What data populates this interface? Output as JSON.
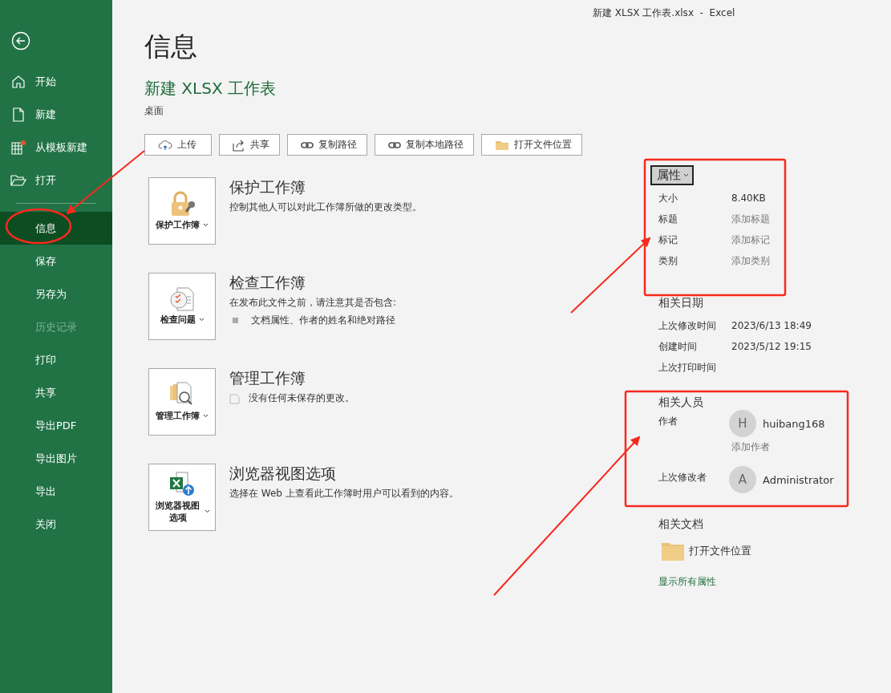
{
  "window": {
    "title": "新建 XLSX 工作表.xlsx  -  Excel"
  },
  "sidebar": {
    "items": [
      {
        "label": "开始",
        "selected": false,
        "disabled": false
      },
      {
        "label": "新建",
        "selected": false,
        "disabled": false
      },
      {
        "label": "从模板新建",
        "selected": false,
        "disabled": false
      },
      {
        "label": "打开",
        "selected": false,
        "disabled": false
      },
      {
        "label": "信息",
        "selected": true,
        "disabled": false
      },
      {
        "label": "保存",
        "selected": false,
        "disabled": false
      },
      {
        "label": "另存为",
        "selected": false,
        "disabled": false
      },
      {
        "label": "历史记录",
        "selected": false,
        "disabled": true
      },
      {
        "label": "打印",
        "selected": false,
        "disabled": false
      },
      {
        "label": "共享",
        "selected": false,
        "disabled": false
      },
      {
        "label": "导出PDF",
        "selected": false,
        "disabled": false
      },
      {
        "label": "导出图片",
        "selected": false,
        "disabled": false
      },
      {
        "label": "导出",
        "selected": false,
        "disabled": false
      },
      {
        "label": "关闭",
        "selected": false,
        "disabled": false
      }
    ]
  },
  "page": {
    "heading": "信息",
    "file_name": "新建 XLSX 工作表",
    "location": "桌面"
  },
  "actions": [
    "上传",
    "共享",
    "复制路径",
    "复制本地路径",
    "打开文件位置"
  ],
  "sections": [
    {
      "button": "保护工作簿",
      "title": "保护工作簿",
      "description": "控制其他人可以对此工作簿所做的更改类型。"
    },
    {
      "button": "检查问题",
      "title": "检查工作簿",
      "description": "在发布此文件之前，请注意其是否包含:",
      "bullets": [
        "文档属性、作者的姓名和绝对路径"
      ]
    },
    {
      "button": "管理工作簿",
      "title": "管理工作簿",
      "description": "没有任何未保存的更改。"
    },
    {
      "button": "浏览器视图选项",
      "title": "浏览器视图选项",
      "description": "选择在 Web 上查看此工作簿时用户可以看到的内容。"
    }
  ],
  "properties": {
    "button": "属性",
    "rows": [
      {
        "label": "大小",
        "value": "8.40KB",
        "placeholder": false
      },
      {
        "label": "标题",
        "value": "添加标题",
        "placeholder": true
      },
      {
        "label": "标记",
        "value": "添加标记",
        "placeholder": true
      },
      {
        "label": "类别",
        "value": "添加类别",
        "placeholder": true
      }
    ]
  },
  "dates": {
    "heading": "相关日期",
    "rows": [
      {
        "label": "上次修改时间",
        "value": "2023/6/13 18:49"
      },
      {
        "label": "创建时间",
        "value": "2023/5/12 19:15"
      },
      {
        "label": "上次打印时间"
      }
    ]
  },
  "people": {
    "heading": "相关人员",
    "author_label": "作者",
    "author": {
      "initial": "H",
      "name": "huibang168"
    },
    "add_author": "添加作者",
    "modified_label": "上次修改者",
    "modifier": {
      "initial": "A",
      "name": "Administrator"
    }
  },
  "documents": {
    "heading": "相关文档",
    "open_location": "打开文件位置",
    "show_all": "显示所有属性"
  }
}
